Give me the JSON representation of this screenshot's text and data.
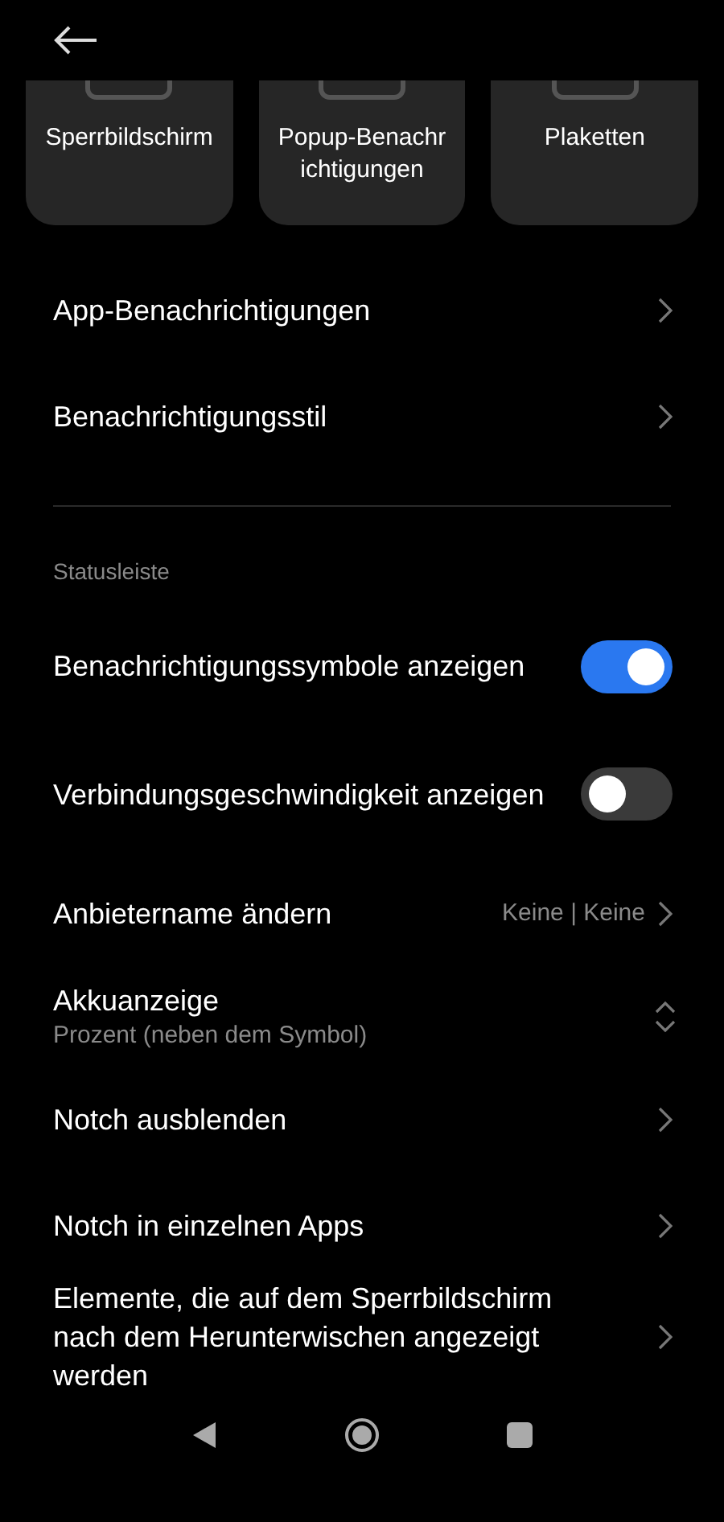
{
  "cards": [
    {
      "label": "Sperrbildschirm"
    },
    {
      "label": "Popup-Benachrichtigungen"
    },
    {
      "label": "Plaketten"
    }
  ],
  "sections": [
    {
      "items": [
        {
          "kind": "link",
          "title": "App-Benachrichtigungen"
        },
        {
          "kind": "link",
          "title": "Benachrichtigungsstil"
        }
      ]
    },
    {
      "title": "Statusleiste",
      "items": [
        {
          "kind": "toggle",
          "title": "Benachrichtigungssymbole anzeigen",
          "on": true
        },
        {
          "kind": "toggle",
          "title": "Verbindungsgeschwindigkeit anzeigen",
          "on": false
        },
        {
          "kind": "link",
          "title": "Anbietername ändern",
          "value": "Keine | Keine"
        },
        {
          "kind": "dropdown",
          "title": "Akkuanzeige",
          "subtitle": "Prozent (neben dem Symbol)"
        },
        {
          "kind": "link",
          "title": "Notch ausblenden"
        },
        {
          "kind": "link",
          "title": "Notch in einzelnen Apps"
        },
        {
          "kind": "link",
          "title": "Elemente, die auf dem Sperrbildschirm nach dem Herunterwischen angezeigt werden"
        }
      ]
    }
  ]
}
